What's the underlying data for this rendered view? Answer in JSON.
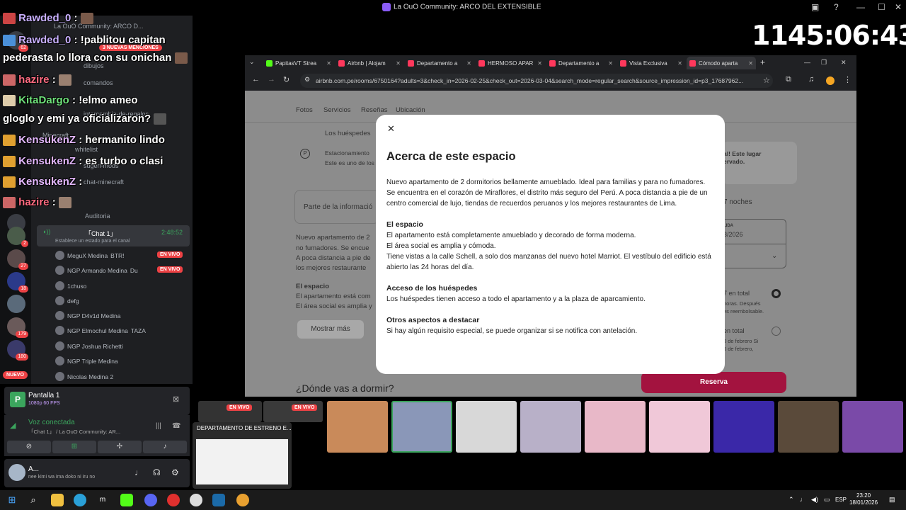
{
  "window": {
    "title": "La OuO Community: ARCO DEL EXTENSIBLE"
  },
  "timer": "1145:06:43",
  "chat": [
    {
      "user": "Rawded_0",
      "text": " :"
    },
    {
      "user": "Rawded_0",
      "text": " : !pablitou capitan"
    },
    {
      "user": "",
      "text": "pederasta lo llora con su onichan"
    },
    {
      "user": "hazire",
      "text": " :"
    },
    {
      "user": "KitaDargo",
      "text": " : !elmo ameo"
    },
    {
      "user": "",
      "text": "gloglo y emi ya oficializaron?"
    },
    {
      "user": "KensukenZ",
      "text": " : hermanito lindo"
    },
    {
      "user": "KensukenZ",
      "text": " : es turbo o clasi"
    },
    {
      "user": "KensukenZ",
      "text": " :"
    },
    {
      "user": "hazire",
      "text": " :"
    }
  ],
  "discord": {
    "server_label": "La OuO Community: ARCO D...",
    "mentions_badge": "3 NUEVAS MENCIONES",
    "channels": [
      "dibujos",
      "comandos",
      "intercambio-de-regalos",
      "Minecraft",
      "whitelist",
      "sugeri-mods",
      "chat-minecraft",
      "Auditoria"
    ],
    "voice_channel": {
      "name": "「Chat 1」",
      "time": "2:48:52",
      "status": "Establece un estado para el canal"
    },
    "members": [
      {
        "name": "MeguX Medina",
        "tag": "BTR!",
        "live": true
      },
      {
        "name": "NGP Armando Medina",
        "tag": "Du",
        "live": true
      },
      {
        "name": "1chuso",
        "tag": "",
        "live": false
      },
      {
        "name": "defg",
        "tag": "",
        "live": false
      },
      {
        "name": "NGP D4v1d Medina",
        "tag": "",
        "live": false
      },
      {
        "name": "NGP Elmochul Medina",
        "tag": "TAZA",
        "live": false
      },
      {
        "name": "NGP Joshua Richetti",
        "tag": "",
        "live": false
      },
      {
        "name": "NGP Triple Medina",
        "tag": "",
        "live": false
      },
      {
        "name": "Nicolas Medina 2",
        "tag": "",
        "live": false
      }
    ],
    "live_label": "EN VIVO",
    "new_label": "NUEVO",
    "guild_badges": [
      "62",
      "2",
      "2",
      "27",
      "18",
      "179",
      "180"
    ],
    "screen_share": {
      "title": "Pantalla 1",
      "sub": "1080p 60 FPS"
    },
    "voice": {
      "title": "Voz conectada",
      "sub": "「Chat 1」 / La OuO Community: AR..."
    },
    "user": {
      "name": "A...",
      "status": "nee kimi wa ima doko ni iru no"
    }
  },
  "browser": {
    "tabs": [
      "PapitasVT Strea",
      "Airbnb | Alojam",
      "Departamento a",
      "HERMOSO APAR",
      "Departamento a",
      "Vista Exclusiva",
      "Cómodo aparta"
    ],
    "url": "airbnb.com.pe/rooms/6750164?adults=3&check_in=2026-02-25&check_out=2026-03-04&search_mode=regular_search&source_impression_id=p3_17687962...",
    "page_nav": [
      "Fotos",
      "Servicios",
      "Reseñas",
      "Ubicación"
    ],
    "bg": {
      "huespedes": "Los huéspedes",
      "estacionamiento": "Estacionamiento",
      "estacionamiento_sub": "Este es uno de los",
      "parte": "Parte de la informació",
      "desc1": "Nuevo apartamento de 2",
      "desc2": "no fumadores. Se encue",
      "desc3": "A poca distancia a pie de",
      "desc4": "los mejores restaurante",
      "espacio": "El espacio",
      "esp1": "El apartamento está com",
      "esp2": "El área social es amplia y",
      "mostrar": "Mostrar más",
      "right1": "al! Este lugar",
      "right2": "ervado.",
      "noches": "7 noches",
      "salida": "LIDA",
      "fecha": "3/2026",
      "total1": "7 en total",
      "total1_sub1": "horas. Después",
      "total1_sub2": "es reembolsable.",
      "total2": "en total",
      "total2_sub1": "0 de febrero Si",
      "total2_sub2": "6 de febrero,"
    },
    "reserve_label": "Reserva",
    "dormir": "¿Dónde vas a dormir?"
  },
  "modal": {
    "title": "Acerca de este espacio",
    "intro": "Nuevo apartamento de 2 dormitorios bellamente amueblado. Ideal para familias y para no fumadores. Se encuentra en el corazón de Miraflores, el distrito más seguro del Perú. A poca distancia a pie de un centro comercial de lujo, tiendas de recuerdos peruanos y los mejores restaurantes de Lima.",
    "sections": [
      {
        "heading": "El espacio",
        "lines": [
          "El apartamento está completamente amueblado y decorado de forma moderna.",
          "El área social es amplia y cómoda.",
          "Tiene vistas a la calle Schell, a solo dos manzanas del nuevo hotel Marriot. El vestíbulo del edificio está abierto las 24 horas del día."
        ]
      },
      {
        "heading": "Acceso de los huéspedes",
        "lines": [
          "Los huéspedes tienen acceso a todo el apartamento y a la plaza de aparcamiento."
        ]
      },
      {
        "heading": "Otros aspectos a destacar",
        "lines": [
          "Si hay algún requisito especial, se puede organizar si se notifica con antelación."
        ]
      }
    ]
  },
  "taskbar_preview": {
    "title": "DEPARTAMENTO DE ESTRENO E..."
  },
  "clock": {
    "time": "23:20",
    "date": "18/01/2026"
  },
  "lang": "ESP",
  "colors": {
    "airbnb": "#ff385c",
    "reserve": "#a3133f",
    "discord_bg": "#1e1f22",
    "live": "#ed4245"
  }
}
